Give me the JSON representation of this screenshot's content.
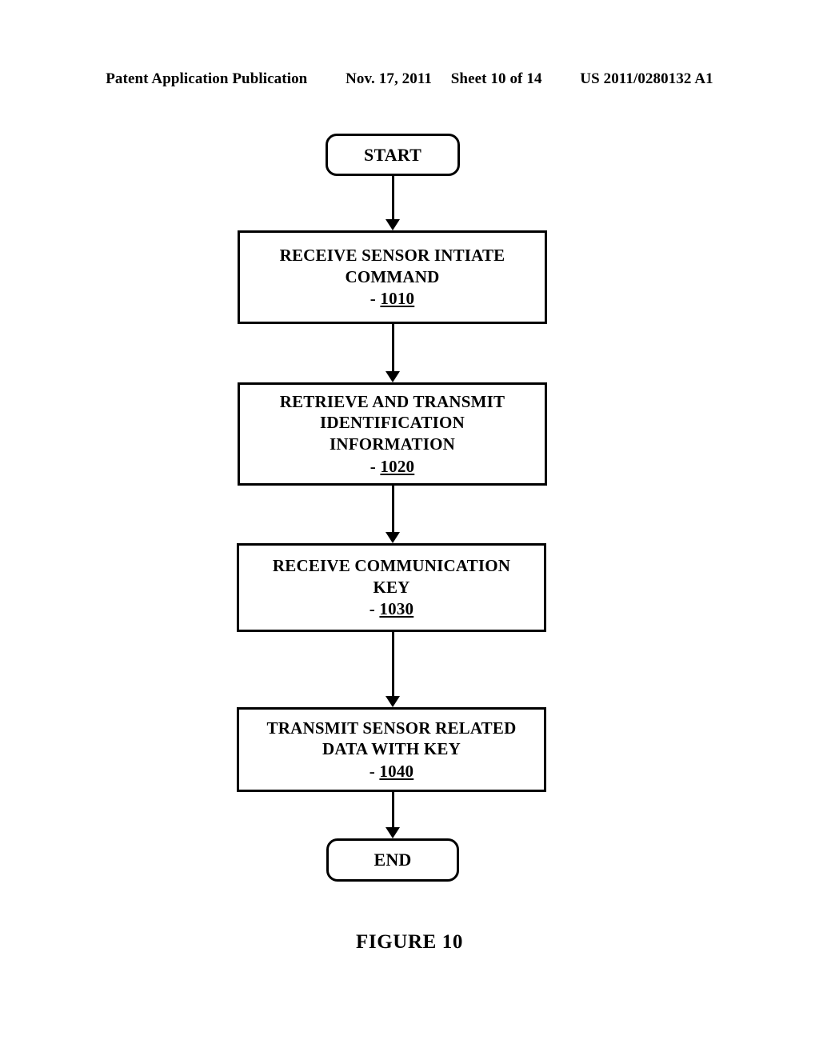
{
  "header": {
    "publication": "Patent Application Publication",
    "date": "Nov. 17, 2011",
    "sheet": "Sheet 10 of 14",
    "patent_number": "US 2011/0280132 A1"
  },
  "caption": {
    "label": "FIGURE 10"
  },
  "flowchart": {
    "nodes": [
      {
        "id": "start",
        "type": "terminator",
        "lines": [
          "START"
        ],
        "refnum_dash": "",
        "refnum": ""
      },
      {
        "id": "step-1010",
        "type": "process",
        "lines": [
          "RECEIVE SENSOR INTIATE",
          "COMMAND"
        ],
        "refnum_dash": "- ",
        "refnum": "1010"
      },
      {
        "id": "step-1020",
        "type": "process",
        "lines": [
          "RETRIEVE AND TRANSMIT",
          "IDENTIFICATION",
          "INFORMATION"
        ],
        "refnum_dash": "- ",
        "refnum": "1020"
      },
      {
        "id": "step-1030",
        "type": "process",
        "lines": [
          "RECEIVE COMMUNICATION",
          "KEY"
        ],
        "refnum_dash": "- ",
        "refnum": "1030"
      },
      {
        "id": "step-1040",
        "type": "process",
        "lines": [
          "TRANSMIT SENSOR RELATED",
          "DATA WITH KEY"
        ],
        "refnum_dash": "- ",
        "refnum": "1040"
      },
      {
        "id": "end",
        "type": "terminator",
        "lines": [
          "END"
        ],
        "refnum_dash": "",
        "refnum": ""
      }
    ],
    "edges": [
      {
        "from": "start",
        "to": "step-1010"
      },
      {
        "from": "step-1010",
        "to": "step-1020"
      },
      {
        "from": "step-1020",
        "to": "step-1030"
      },
      {
        "from": "step-1030",
        "to": "step-1040"
      },
      {
        "from": "step-1040",
        "to": "end"
      }
    ],
    "colors": {
      "stroke": "#000000",
      "fill": "#ffffff"
    }
  }
}
